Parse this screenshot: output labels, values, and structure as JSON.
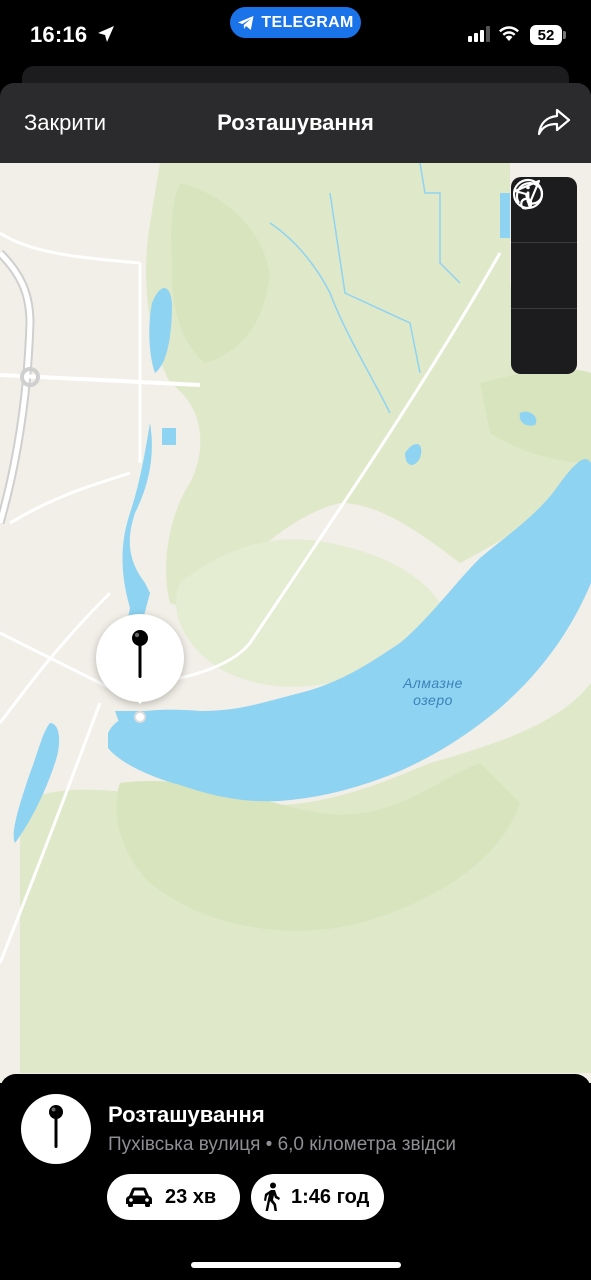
{
  "status_bar": {
    "time": "16:16",
    "return_app": "TELEGRAM",
    "battery": "52"
  },
  "nav": {
    "close_label": "Закрити",
    "title": "Розташування"
  },
  "map": {
    "lake_label_line1": "Алмазне",
    "lake_label_line2": "озеро",
    "controls": [
      "info-icon",
      "location-arrow-icon",
      "look-around-icon"
    ]
  },
  "place": {
    "title": "Розташування",
    "subtitle": "Пухівська вулиця • 6,0 кілометра звідси",
    "drive_time": "23 хв",
    "walk_time": "1:46 год"
  },
  "colors": {
    "accent": "#1a73e8",
    "water": "#8fd3f2",
    "park": "#dfe9c9",
    "land": "#f1efe7"
  }
}
